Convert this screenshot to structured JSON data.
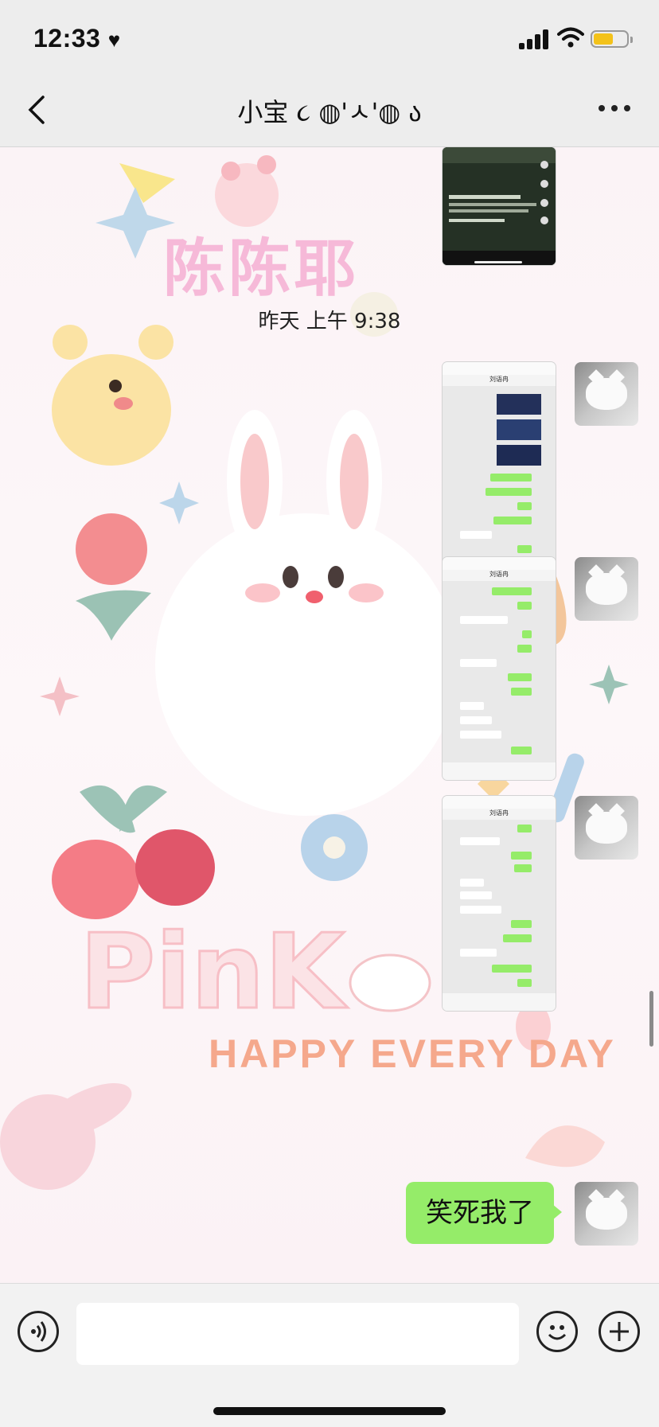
{
  "status_bar": {
    "time": "12:33"
  },
  "header": {
    "title": "小宝 ૮ ˶ᵔ ᵕ ᵔ˶ ა",
    "title_display": "小宝 ૮ ◍'ㅅ'◍ ა",
    "back_icon": "chevron-left-icon",
    "more_icon": "more-dots-icon"
  },
  "chat": {
    "timestamp": "昨天 上午 9:38",
    "wallpaper_texts": {
      "name": "陈陈耶",
      "pink": "PinK",
      "happy": "HAPPY EVERY DAY"
    },
    "messages": [
      {
        "type": "image",
        "from": "me",
        "description": "video-screenshot"
      },
      {
        "type": "image",
        "from": "me",
        "description": "chat-screenshot",
        "header": "刘语冉"
      },
      {
        "type": "image",
        "from": "me",
        "description": "chat-screenshot",
        "header": "刘语冉"
      },
      {
        "type": "image",
        "from": "me",
        "description": "chat-screenshot",
        "header": "刘语冉"
      },
      {
        "type": "text",
        "from": "me",
        "text": "笑死我了"
      }
    ]
  },
  "input_bar": {
    "voice_icon": "voice-icon",
    "emoji_icon": "emoji-icon",
    "plus_icon": "plus-icon"
  },
  "colors": {
    "bubble_green": "#95ec69",
    "header_bg": "#ededed"
  }
}
